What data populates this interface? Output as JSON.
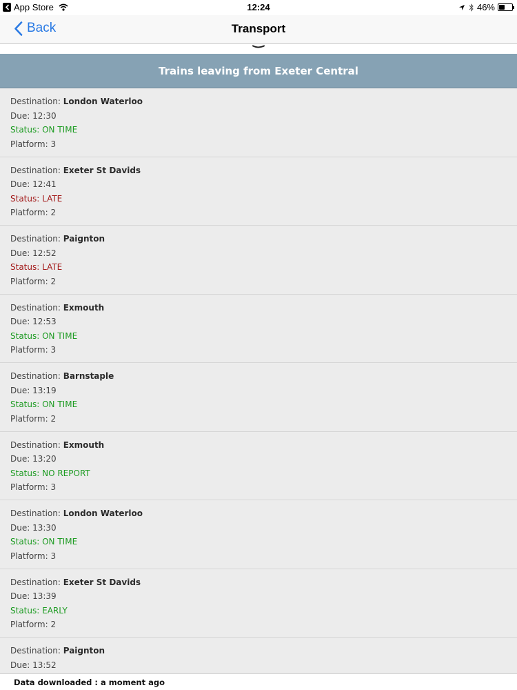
{
  "status_bar": {
    "back_app": "App Store",
    "time": "12:24",
    "battery": "46%",
    "battery_level": 0.46
  },
  "nav": {
    "back_label": "Back",
    "title": "Transport"
  },
  "banner": "Trains leaving from Exeter Central",
  "labels": {
    "destination": "Destination: ",
    "due": "Due: ",
    "status": "Status: ",
    "platform": "Platform: "
  },
  "trains": [
    {
      "destination": "London Waterloo",
      "due": "12:30",
      "status": "ON TIME",
      "status_color": "#1c9b21",
      "platform": "3"
    },
    {
      "destination": "Exeter St Davids",
      "due": "12:41",
      "status": "LATE",
      "status_color": "#a31a1a",
      "platform": "2"
    },
    {
      "destination": "Paignton",
      "due": "12:52",
      "status": "LATE",
      "status_color": "#a31a1a",
      "platform": "2"
    },
    {
      "destination": "Exmouth",
      "due": "12:53",
      "status": "ON TIME",
      "status_color": "#1c9b21",
      "platform": "3"
    },
    {
      "destination": "Barnstaple",
      "due": "13:19",
      "status": "ON TIME",
      "status_color": "#1c9b21",
      "platform": "2"
    },
    {
      "destination": "Exmouth",
      "due": "13:20",
      "status": "NO REPORT",
      "status_color": "#1c9b21",
      "platform": "3"
    },
    {
      "destination": "London Waterloo",
      "due": "13:30",
      "status": "ON TIME",
      "status_color": "#1c9b21",
      "platform": "3"
    },
    {
      "destination": "Exeter St Davids",
      "due": "13:39",
      "status": "EARLY",
      "status_color": "#1c9b21",
      "platform": "2"
    },
    {
      "destination": "Paignton",
      "due": "13:52"
    }
  ],
  "footer": "Data downloaded : a moment ago",
  "colors": {
    "accent": "#2a7ae4",
    "banner": "#86a2b4",
    "status_green": "#1c9b21",
    "status_red": "#a31a1a"
  }
}
